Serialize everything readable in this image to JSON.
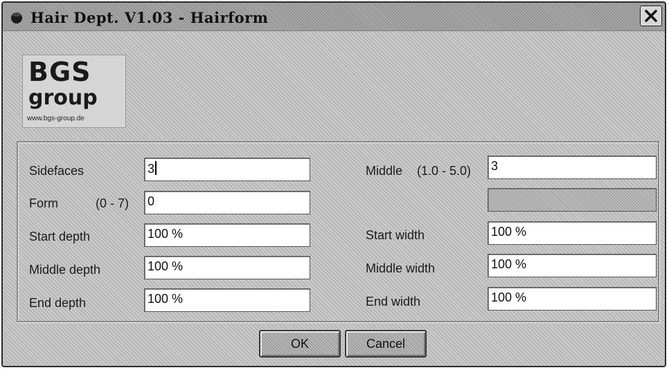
{
  "window": {
    "title": "Hair Dept. V1.03 - Hairform",
    "close_label": "✕"
  },
  "logo": {
    "line1": "BGS",
    "line2": "group",
    "url": "www.bgs-group.de"
  },
  "form": {
    "left": [
      {
        "label": "Sidefaces",
        "value": "3"
      },
      {
        "label": "Form",
        "range": "(0 - 7)",
        "value": "0"
      },
      {
        "label": "Start depth",
        "value": "100 %"
      },
      {
        "label": "Middle depth",
        "value": "100 %"
      },
      {
        "label": "End depth",
        "value": "100 %"
      }
    ],
    "right": [
      {
        "label": "Middle",
        "range": "(1.0 - 5.0)",
        "value": "3"
      },
      {
        "label": "",
        "value": ""
      },
      {
        "label": "Start width",
        "value": "100 %"
      },
      {
        "label": "Middle width",
        "value": "100 %"
      },
      {
        "label": "End width",
        "value": "100 %"
      }
    ]
  },
  "buttons": {
    "ok": "OK",
    "cancel": "Cancel"
  }
}
